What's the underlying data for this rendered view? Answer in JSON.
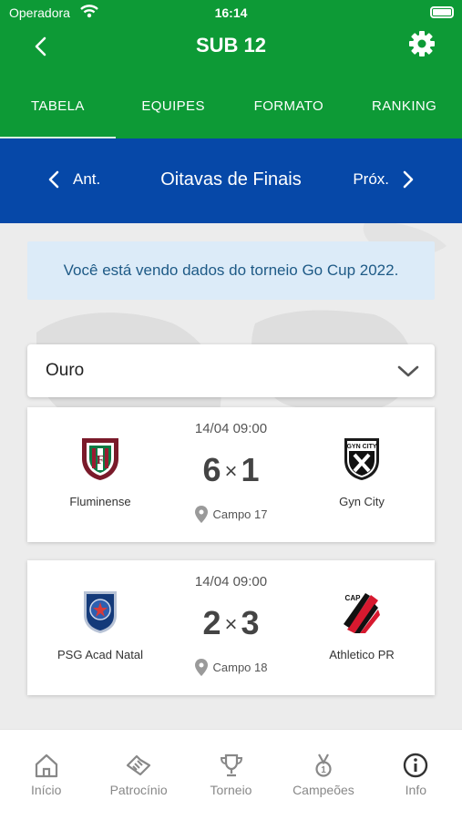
{
  "status": {
    "carrier": "Operadora",
    "time": "16:14"
  },
  "header": {
    "title": "SUB 12"
  },
  "tabs": [
    {
      "label": "TABELA",
      "active": true
    },
    {
      "label": "EQUIPES",
      "active": false
    },
    {
      "label": "FORMATO",
      "active": false
    },
    {
      "label": "RANKING",
      "active": false
    }
  ],
  "round": {
    "prev_label": "Ant.",
    "title": "Oitavas de Finais",
    "next_label": "Próx."
  },
  "notice": "Você está vendo dados do torneio Go Cup 2022.",
  "group_select": {
    "value": "Ouro"
  },
  "matches": [
    {
      "datetime": "14/04 09:00",
      "home": {
        "name": "Fluminense",
        "score": "6",
        "crest": "fluminense-crest"
      },
      "separator": "×",
      "away": {
        "name": "Gyn City",
        "score": "1",
        "crest": "gyn-city-crest",
        "crest_text": "GYN CITY"
      },
      "place": "Campo 17"
    },
    {
      "datetime": "14/04 09:00",
      "home": {
        "name": "PSG Acad Natal",
        "score": "2",
        "crest": "psg-crest"
      },
      "separator": "×",
      "away": {
        "name": "Athletico PR",
        "score": "3",
        "crest": "athletico-crest",
        "crest_text": "CAP"
      },
      "place": "Campo 18"
    }
  ],
  "bottom_nav": [
    {
      "label": "Início",
      "icon": "home-icon"
    },
    {
      "label": "Patrocínio",
      "icon": "handshake-icon"
    },
    {
      "label": "Torneio",
      "icon": "trophy-icon"
    },
    {
      "label": "Campeões",
      "icon": "medal-icon"
    },
    {
      "label": "Info",
      "icon": "info-icon"
    }
  ],
  "colors": {
    "header_green": "#0d9a36",
    "round_blue": "#0648a8",
    "notice_bg": "#dcebf8",
    "notice_text": "#1e5a86"
  }
}
